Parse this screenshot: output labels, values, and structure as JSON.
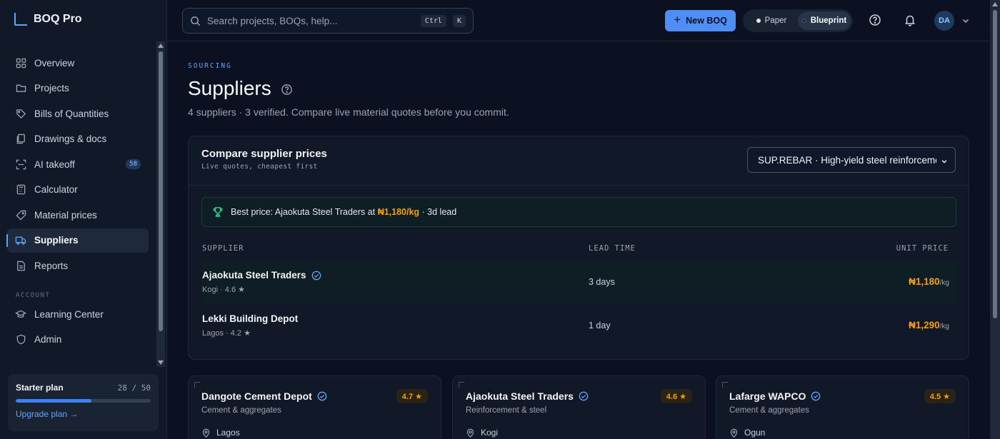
{
  "app": {
    "name": "BOQ Pro",
    "brand_color": "#60a5fa"
  },
  "sidebar": {
    "items": [
      {
        "label": "Overview",
        "icon": "grid-icon"
      },
      {
        "label": "Projects",
        "icon": "folder-icon"
      },
      {
        "label": "Bills of Quantities",
        "icon": "tag-icon"
      },
      {
        "label": "Drawings & docs",
        "icon": "documents-icon"
      },
      {
        "label": "AI takeoff",
        "icon": "scan-icon",
        "badge": "58"
      },
      {
        "label": "Calculator",
        "icon": "calculator-icon"
      },
      {
        "label": "Material prices",
        "icon": "price-tag-icon"
      },
      {
        "label": "Suppliers",
        "icon": "truck-icon",
        "active": true
      },
      {
        "label": "Reports",
        "icon": "report-icon"
      }
    ],
    "account_section": "ACCOUNT",
    "account_items": [
      {
        "label": "Learning Center",
        "icon": "graduation-cap-icon"
      },
      {
        "label": "Admin",
        "icon": "shield-icon"
      }
    ],
    "plan": {
      "title": "Starter plan",
      "count": "28 / 50",
      "used_fraction": 0.56,
      "upgrade_label": "Upgrade plan →"
    }
  },
  "topbar": {
    "search_placeholder": "Search projects, BOQs, help...",
    "shortcut_ctrl": "Ctrl",
    "shortcut_key": "K",
    "new_button": "New BOQ",
    "theme_paper": "Paper",
    "theme_blueprint": "Blueprint",
    "avatar_initials": "DA"
  },
  "page": {
    "eyebrow": "SOURCING",
    "title": "Suppliers",
    "subtitle": "4 suppliers · 3 verified. Compare live material quotes before you commit."
  },
  "compare": {
    "title": "Compare supplier prices",
    "subtitle": "Live quotes, cheapest first",
    "selected_material": "SUP.REBAR · High-yield steel reinforcement",
    "best_prefix": "Best price: Ajaokuta Steel Traders at",
    "best_price": "₦1,180/kg",
    "best_suffix": "· 3d lead",
    "columns": {
      "supplier": "SUPPLIER",
      "lead_time": "LEAD TIME",
      "unit_price": "UNIT PRICE"
    },
    "rows": [
      {
        "name": "Ajaokuta Steel Traders",
        "verified": true,
        "meta": "Kogi · 4.6 ★",
        "lead": "3 days",
        "price": "₦1,180",
        "unit": "/kg"
      },
      {
        "name": "Lekki Building Depot",
        "verified": false,
        "meta": "Lagos · 4.2 ★",
        "lead": "1 day",
        "price": "₦1,290",
        "unit": "/kg"
      }
    ]
  },
  "cards": [
    {
      "name": "Dangote Cement Depot",
      "verified": true,
      "category": "Cement & aggregates",
      "rating": "4.7 ★",
      "location": "Lagos"
    },
    {
      "name": "Ajaokuta Steel Traders",
      "verified": true,
      "category": "Reinforcement & steel",
      "rating": "4.6 ★",
      "location": "Kogi"
    },
    {
      "name": "Lafarge WAPCO",
      "verified": true,
      "category": "Cement & aggregates",
      "rating": "4.5 ★",
      "location": "Ogun"
    }
  ]
}
